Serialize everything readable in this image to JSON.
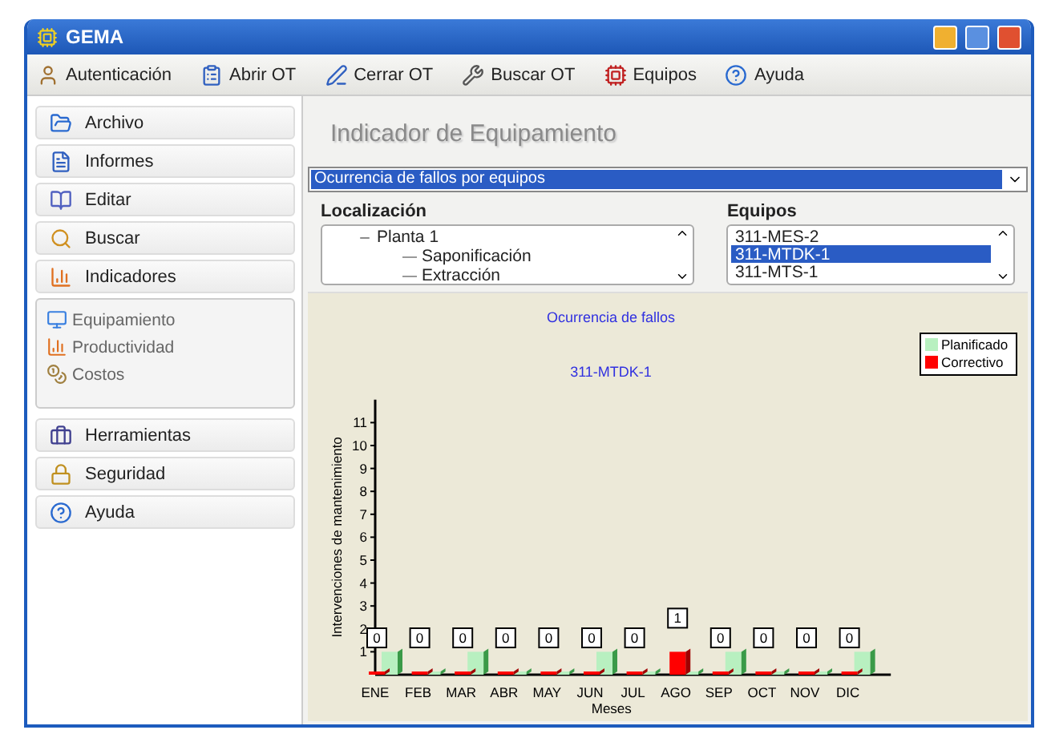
{
  "window": {
    "title": "GEMA"
  },
  "toolbar": [
    {
      "label": "Autenticación"
    },
    {
      "label": "Abrir OT"
    },
    {
      "label": "Cerrar OT"
    },
    {
      "label": "Buscar OT"
    },
    {
      "label": "Equipos"
    },
    {
      "label": "Ayuda"
    }
  ],
  "sidebar": {
    "sections": [
      {
        "label": "Archivo"
      },
      {
        "label": "Informes"
      },
      {
        "label": "Editar"
      },
      {
        "label": "Buscar"
      },
      {
        "label": "Indicadores",
        "items": [
          {
            "label": "Equipamiento"
          },
          {
            "label": "Productividad"
          },
          {
            "label": "Costos"
          }
        ]
      },
      {
        "label": "Herramientas"
      },
      {
        "label": "Seguridad"
      },
      {
        "label": "Ayuda"
      }
    ]
  },
  "main": {
    "heading": "Indicador de Equipamiento",
    "indicator_select": {
      "value": "Ocurrencia de fallos por equipos"
    },
    "location": {
      "label": "Localización",
      "tree": [
        {
          "label": "Planta 1",
          "expanded": true,
          "children": [
            {
              "label": "Saponificación"
            },
            {
              "label": "Extracción"
            }
          ]
        }
      ]
    },
    "equipment": {
      "label": "Equipos",
      "items": [
        {
          "label": "311-MES-2",
          "selected": false
        },
        {
          "label": "311-MTDK-1",
          "selected": true
        },
        {
          "label": "311-MTS-1",
          "selected": false
        }
      ]
    },
    "chart": {
      "subtitle": "311-MTDK-1",
      "chart_data": {
        "type": "bar",
        "title": "Ocurrencia de fallos",
        "xlabel": "Meses",
        "ylabel": "Intervenciones de mantenimiento",
        "categories": [
          "ENE",
          "FEB",
          "MAR",
          "ABR",
          "MAY",
          "JUN",
          "JUL",
          "AGO",
          "SEP",
          "OCT",
          "NOV",
          "DIC"
        ],
        "series": [
          {
            "name": "Planificado",
            "color": "#b8f0c0",
            "values": [
              1,
              0,
              1,
              0,
              0,
              1,
              0,
              0,
              1,
              0,
              0,
              1
            ]
          },
          {
            "name": "Correctivo",
            "color": "#ff0000",
            "values": [
              0,
              0,
              0,
              0,
              0,
              0,
              0,
              1,
              0,
              0,
              0,
              0
            ]
          }
        ],
        "legend": "upper right",
        "ylim": [
          0,
          12
        ],
        "yticks": [
          1,
          2,
          3,
          4,
          5,
          6,
          7,
          8,
          9,
          10,
          11
        ],
        "value_labels": [
          "0",
          "0",
          "0",
          "0",
          "0",
          "0",
          "0",
          "1",
          "0",
          "0",
          "0",
          "0"
        ]
      }
    }
  }
}
